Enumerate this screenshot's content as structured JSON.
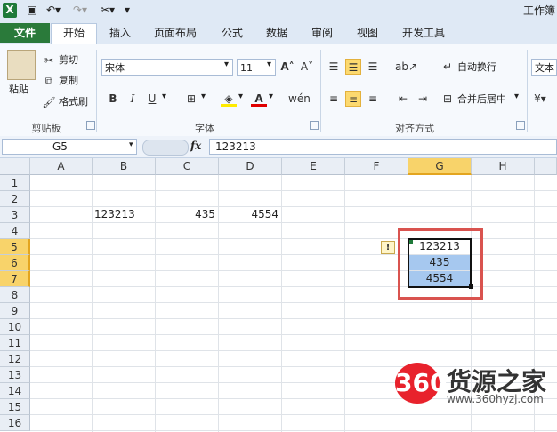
{
  "app": {
    "window_title": "工作簿"
  },
  "tabs": [
    "文件",
    "开始",
    "插入",
    "页面布局",
    "公式",
    "数据",
    "审阅",
    "视图",
    "开发工具"
  ],
  "clipboard": {
    "paste": "粘贴",
    "cut": "剪切",
    "copy": "复制",
    "format_painter": "格式刷",
    "group": "剪贴板"
  },
  "font": {
    "name": "宋体",
    "size": "11",
    "group": "字体",
    "bold": "B",
    "italic": "I",
    "underline": "U"
  },
  "alignment": {
    "wrap": "自动换行",
    "merge": "合并后居中",
    "group": "对齐方式"
  },
  "number": {
    "format": "文本"
  },
  "formula_bar": {
    "name_box": "G5",
    "fx": "fx",
    "value": "123213"
  },
  "columns": [
    "A",
    "B",
    "C",
    "D",
    "E",
    "F",
    "G",
    "H"
  ],
  "rows": [
    "1",
    "2",
    "3",
    "4",
    "5",
    "6",
    "7",
    "8",
    "9",
    "10",
    "11",
    "12",
    "13",
    "14",
    "15",
    "16"
  ],
  "cells": {
    "B3": "123213",
    "C3": "435",
    "D3": "4554",
    "G5": "123213",
    "G6": "435",
    "G7": "4554"
  },
  "watermark": {
    "badge": "360",
    "name": "货源之家",
    "url": "www.360hyzj.com"
  }
}
